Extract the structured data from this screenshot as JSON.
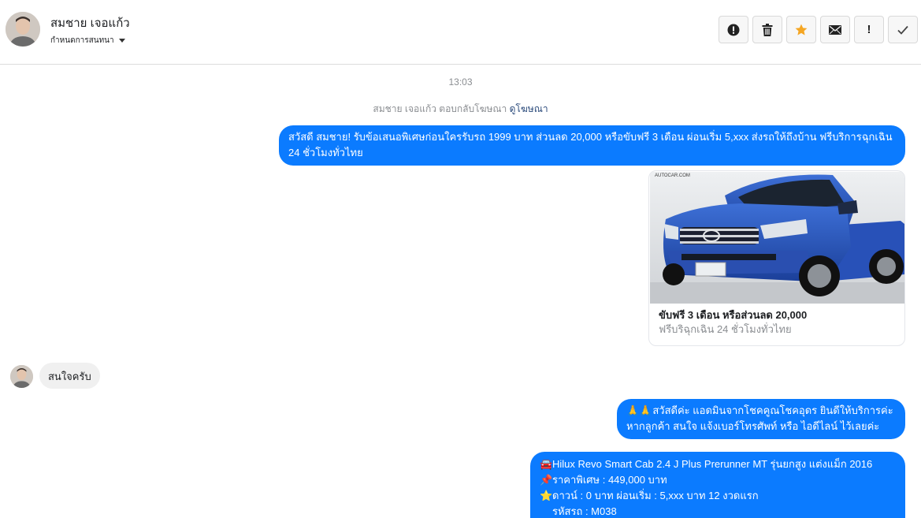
{
  "header": {
    "contact_name": "สมชาย เจอแก้ว",
    "conversation_settings": "กำหนดการสนทนา"
  },
  "toolbar": {
    "buttons": [
      {
        "icon": "alert-circle-icon"
      },
      {
        "icon": "trash-icon"
      },
      {
        "icon": "star-icon",
        "color": "#f5a623"
      },
      {
        "icon": "envelope-icon"
      },
      {
        "icon": "exclamation-icon",
        "label": "!"
      },
      {
        "icon": "check-icon"
      }
    ]
  },
  "chat": {
    "timestamp": "13:03",
    "reply_note": {
      "text": "สมชาย เจอแก้ว ตอบกลับโฆษณา",
      "link": "ดูโฆษณา"
    },
    "messages": [
      {
        "direction": "outgoing",
        "text": "สวัสดี สมชาย! รับข้อเสนอพิเศษก่อนใครรับรถ 1999 บาท ส่วนลด 20,000 หรือขับฟรี 3 เดือน ผ่อนเริ่ม 5,xxx ส่งรถให้ถึงบ้าน ฟรีบริการฉุกเฉิน 24 ชั่วโมงทั่วไทย"
      },
      {
        "direction": "outgoing",
        "type": "card",
        "image_brand": "AUTOCAR.COM",
        "title": "ขับฟรี 3 เดือน หรือส่วนลด 20,000",
        "subtitle": "ฟรีบริฉุกเฉิน 24 ชั่วโมงทั่วไทย"
      },
      {
        "direction": "incoming",
        "text": "สนใจครับ"
      },
      {
        "direction": "outgoing",
        "emoji": "🙏🙏",
        "text": "สวัสดีค่ะ แอดมินจากโชคคูณโชคอุดร ยินดีให้บริการค่ะ หากลูกค้า สนใจ แจ้งเบอร์โทรศัพท์ หรือ ไอดีไลน์ ไว้เลยค่ะ"
      },
      {
        "direction": "outgoing",
        "lines": [
          {
            "emoji": "🚘",
            "text": "Hilux Revo Smart Cab 2.4 J Plus Prerunner MT รุ่นยกสูง แต่งแม็ก 2016"
          },
          {
            "emoji": "📌",
            "text": "ราคาพิเศษ : 449,000 บาท"
          },
          {
            "emoji": "⭐",
            "text": "ดาวน์ : 0 บาท ผ่อนเริ่ม : 5,xxx บาท 12 งวดแรก"
          },
          {
            "emoji": "",
            "text": "รหัสรถ : M038"
          }
        ]
      }
    ]
  },
  "colors": {
    "outgoing_bubble": "#0b7bff",
    "incoming_bubble": "#f0f0f0",
    "star": "#f5a623"
  }
}
